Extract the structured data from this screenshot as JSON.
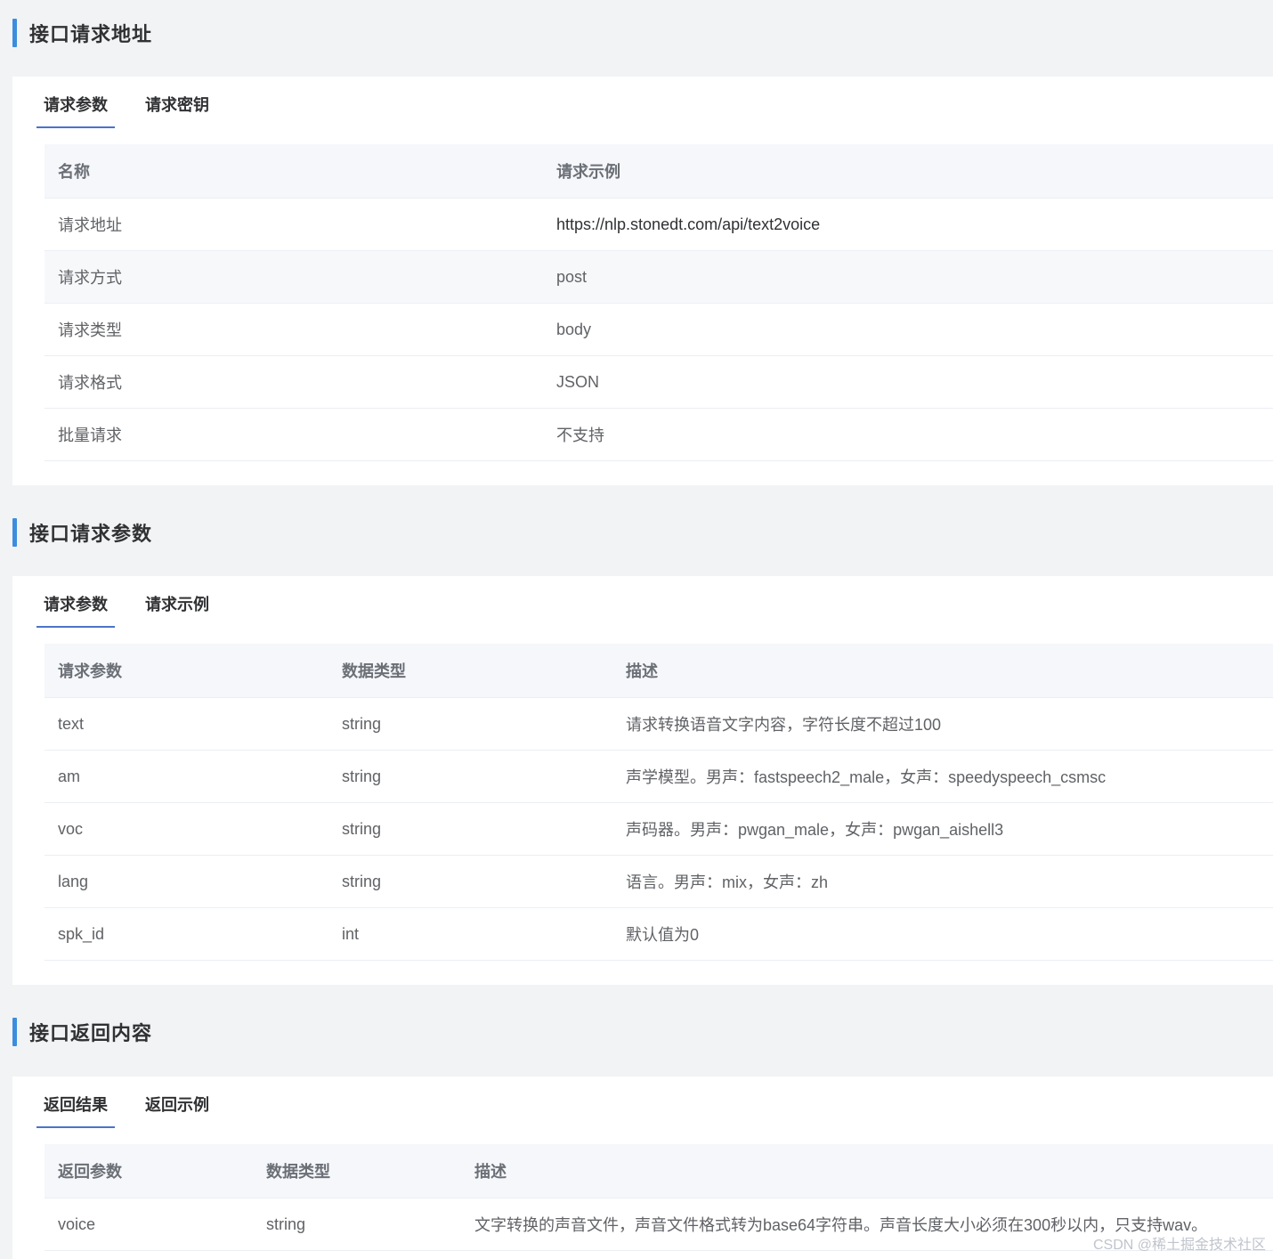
{
  "sections": [
    {
      "title": "接口请求地址",
      "tabs": [
        "请求参数",
        "请求密钥"
      ],
      "headers": [
        "名称",
        "请求示例"
      ],
      "rows": [
        [
          "请求地址",
          "https://nlp.stonedt.com/api/text2voice"
        ],
        [
          "请求方式",
          "post"
        ],
        [
          "请求类型",
          "body"
        ],
        [
          "请求格式",
          "JSON"
        ],
        [
          "批量请求",
          "不支持"
        ]
      ]
    },
    {
      "title": "接口请求参数",
      "tabs": [
        "请求参数",
        "请求示例"
      ],
      "headers": [
        "请求参数",
        "数据类型",
        "描述"
      ],
      "rows": [
        [
          "text",
          "string",
          "请求转换语音文字内容，字符长度不超过100"
        ],
        [
          "am",
          "string",
          "声学模型。男声：fastspeech2_male，女声：speedyspeech_csmsc"
        ],
        [
          "voc",
          "string",
          "声码器。男声：pwgan_male，女声：pwgan_aishell3"
        ],
        [
          "lang",
          "string",
          "语言。男声：mix，女声：zh"
        ],
        [
          "spk_id",
          "int",
          "默认值为0"
        ]
      ]
    },
    {
      "title": "接口返回内容",
      "tabs": [
        "返回结果",
        "返回示例"
      ],
      "headers": [
        "返回参数",
        "数据类型",
        "描述"
      ],
      "rows": [
        [
          "voice",
          "string",
          "文字转换的声音文件，声音文件格式转为base64字符串。声音长度大小必须在300秒以内，只支持wav。"
        ]
      ]
    }
  ],
  "watermark": "CSDN @稀土掘金技术社区",
  "colors": {
    "accent_bar": "#3c8dde",
    "tab_underline": "#4a74c9",
    "page_bg": "#f2f3f5"
  }
}
